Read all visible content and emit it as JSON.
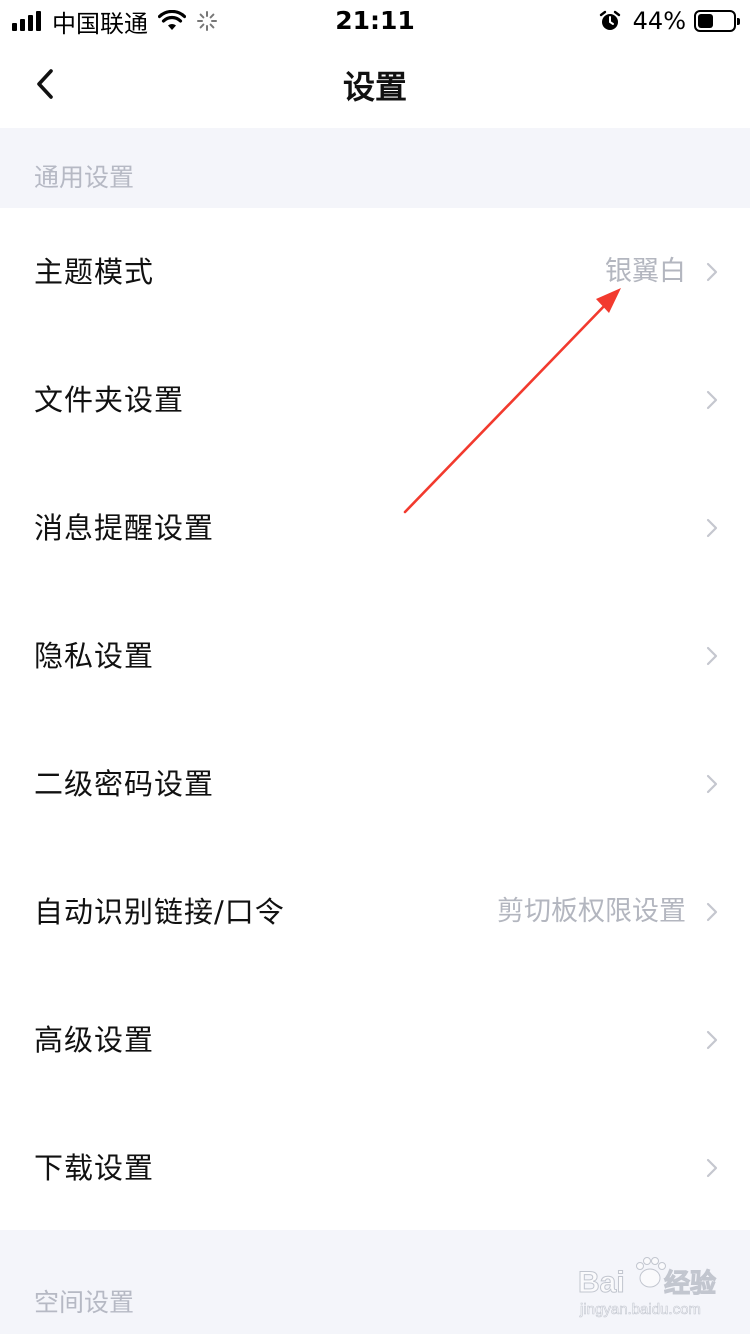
{
  "status_bar": {
    "carrier": "中国联通",
    "time": "21:11",
    "battery_percent": "44%",
    "battery_level": 0.44,
    "signal_bars": 4,
    "icons": [
      "signal-icon",
      "wifi-icon",
      "loading-spinner-icon",
      "alarm-icon",
      "battery-icon"
    ]
  },
  "nav": {
    "title": "设置",
    "back_icon": "back-chevron-icon"
  },
  "sections": {
    "general_title": "通用设置",
    "space_title": "空间设置"
  },
  "items": [
    {
      "label": "主题模式",
      "value": "银翼白"
    },
    {
      "label": "文件夹设置",
      "value": ""
    },
    {
      "label": "消息提醒设置",
      "value": ""
    },
    {
      "label": "隐私设置",
      "value": ""
    },
    {
      "label": "二级密码设置",
      "value": ""
    },
    {
      "label": "自动识别链接/口令",
      "value": "剪切板权限设置"
    },
    {
      "label": "高级设置",
      "value": ""
    },
    {
      "label": "下载设置",
      "value": ""
    }
  ],
  "annotation": {
    "type": "arrow",
    "color": "#f23a2e"
  },
  "watermark": {
    "brand": "Baidu经验",
    "url": "jingyan.baidu.com"
  },
  "colors": {
    "section_background": "#f4f5fa",
    "section_text": "#b6b9c4",
    "secondary_text": "#b3b6bf",
    "chevron": "#c5c7cf"
  }
}
